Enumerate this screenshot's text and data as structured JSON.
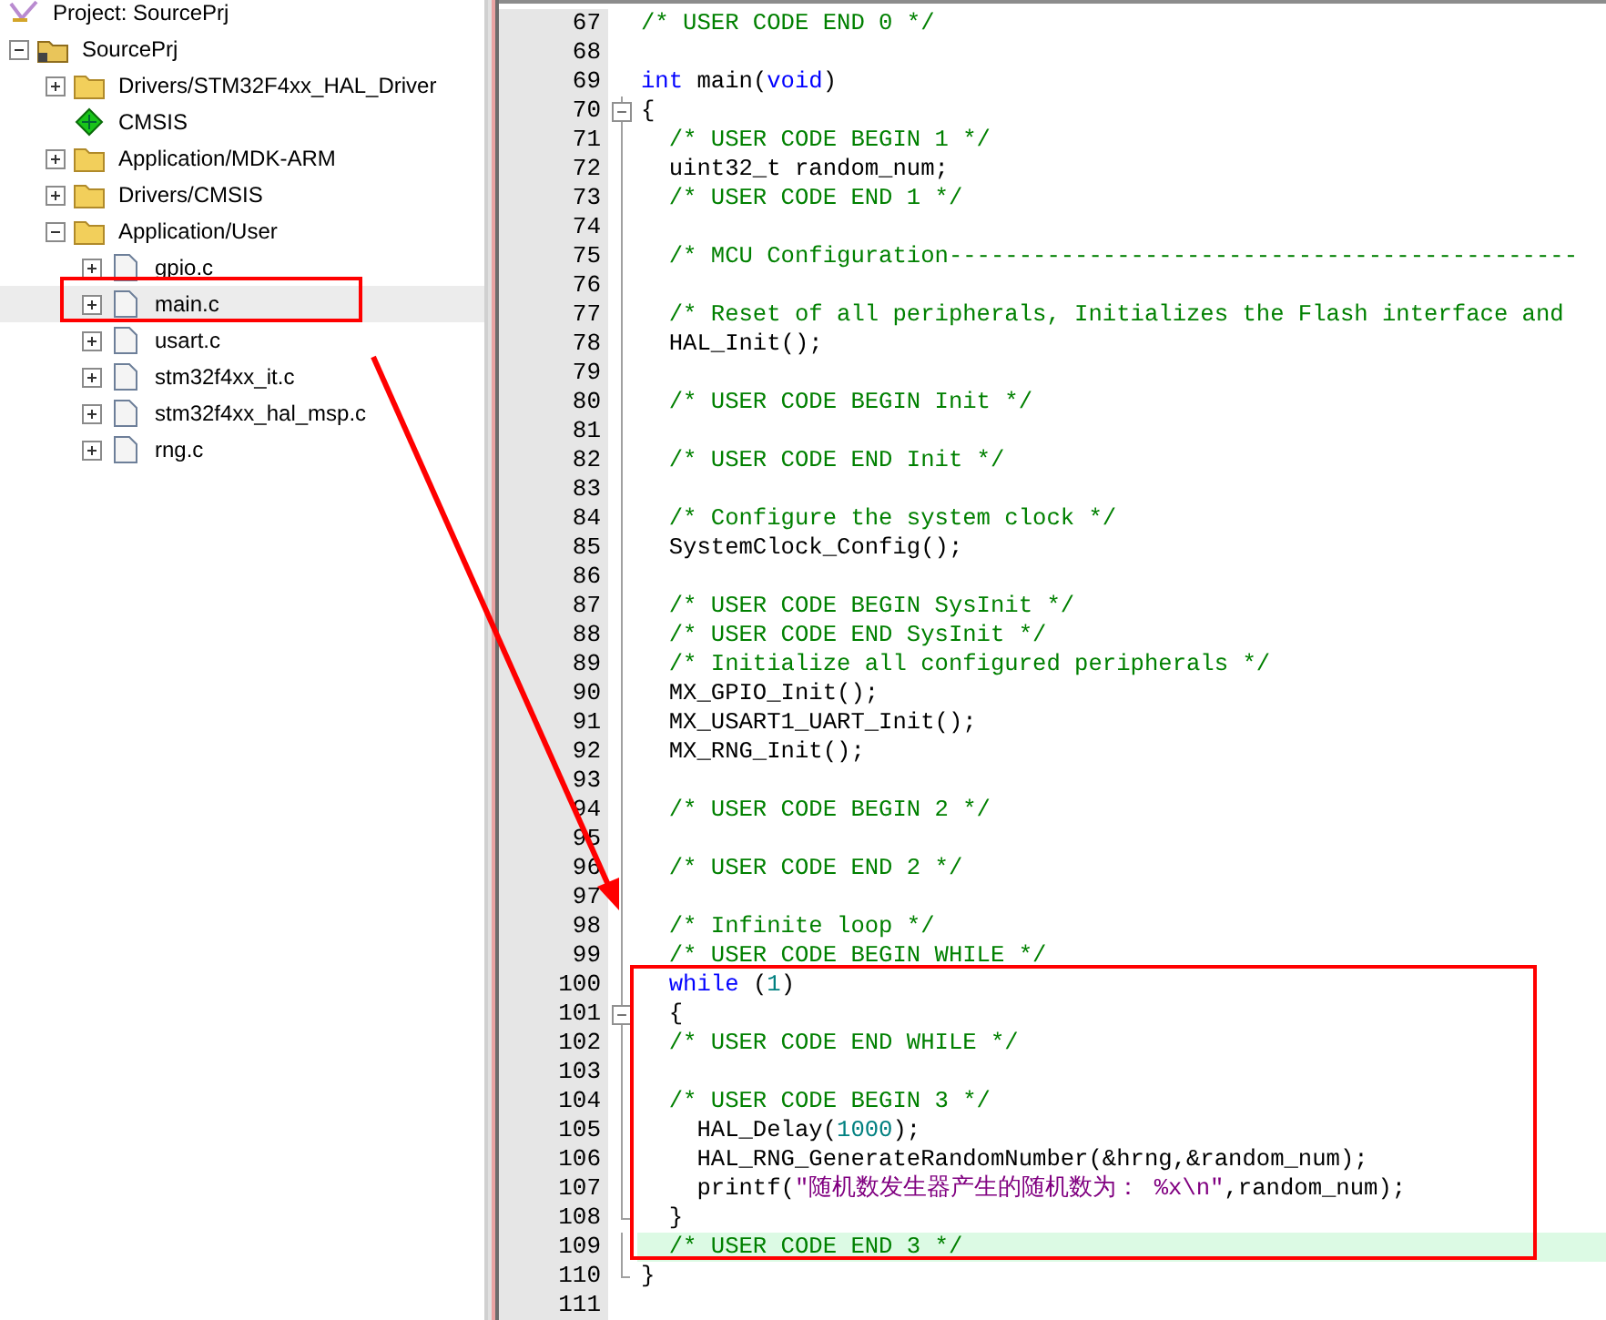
{
  "project_panel": {
    "title": "Project: SourcePrj",
    "tree": [
      {
        "label": "SourcePrj",
        "kind": "project",
        "expanded": true,
        "selected": false,
        "children": [
          {
            "label": "Drivers/STM32F4xx_HAL_Driver",
            "kind": "folder",
            "expanded": false,
            "selected": false
          },
          {
            "label": "CMSIS",
            "kind": "component",
            "selected": false
          },
          {
            "label": "Application/MDK-ARM",
            "kind": "folder",
            "expanded": false,
            "selected": false
          },
          {
            "label": "Drivers/CMSIS",
            "kind": "folder",
            "expanded": false,
            "selected": false
          },
          {
            "label": "Application/User",
            "kind": "folder",
            "expanded": true,
            "selected": false,
            "children": [
              {
                "label": "gpio.c",
                "kind": "file",
                "expanded": false,
                "selected": false
              },
              {
                "label": "main.c",
                "kind": "file",
                "expanded": false,
                "selected": true
              },
              {
                "label": "usart.c",
                "kind": "file",
                "expanded": false,
                "selected": false
              },
              {
                "label": "stm32f4xx_it.c",
                "kind": "file",
                "expanded": false,
                "selected": false
              },
              {
                "label": "stm32f4xx_hal_msp.c",
                "kind": "file",
                "expanded": false,
                "selected": false
              },
              {
                "label": "rng.c",
                "kind": "file",
                "expanded": false,
                "selected": false
              }
            ]
          }
        ]
      }
    ]
  },
  "editor": {
    "lines": [
      {
        "number": "67",
        "current": false,
        "kind": "plain",
        "tokens": [
          {
            "kind": "comment",
            "text": "/* USER CODE END 0 */"
          }
        ]
      },
      {
        "number": "68",
        "current": false,
        "kind": "plain"
      },
      {
        "number": "69",
        "current": false,
        "kind": "plain",
        "tokens": [
          {
            "kind": "keyword",
            "text": "int"
          },
          {
            "kind": "plain",
            "text": " main("
          },
          {
            "kind": "keyword",
            "text": "void"
          },
          {
            "kind": "plain",
            "text": ")"
          }
        ]
      },
      {
        "number": "70",
        "current": false,
        "kind": "open",
        "tokens": [
          {
            "kind": "plain",
            "text": "{"
          }
        ]
      },
      {
        "number": "71",
        "current": false,
        "kind": "body",
        "tokens": [
          {
            "kind": "comment",
            "text": "  /* USER CODE BEGIN 1 */"
          }
        ]
      },
      {
        "number": "72",
        "current": false,
        "kind": "body",
        "tokens": [
          {
            "kind": "plain",
            "text": "  uint32_t random_num;"
          }
        ]
      },
      {
        "number": "73",
        "current": false,
        "kind": "body",
        "tokens": [
          {
            "kind": "comment",
            "text": "  /* USER CODE END 1 */"
          }
        ]
      },
      {
        "number": "74",
        "current": false,
        "kind": "body"
      },
      {
        "number": "75",
        "current": false,
        "kind": "body",
        "tokens": [
          {
            "kind": "comment",
            "text": "  /* MCU Configuration---------------------------------------------"
          }
        ]
      },
      {
        "number": "76",
        "current": false,
        "kind": "body"
      },
      {
        "number": "77",
        "current": false,
        "kind": "body",
        "tokens": [
          {
            "kind": "comment",
            "text": "  /* Reset of all peripherals, Initializes the Flash interface and"
          }
        ]
      },
      {
        "number": "78",
        "current": false,
        "kind": "body",
        "tokens": [
          {
            "kind": "plain",
            "text": "  HAL_Init();"
          }
        ]
      },
      {
        "number": "79",
        "current": false,
        "kind": "body"
      },
      {
        "number": "80",
        "current": false,
        "kind": "body",
        "tokens": [
          {
            "kind": "comment",
            "text": "  /* USER CODE BEGIN Init */"
          }
        ]
      },
      {
        "number": "81",
        "current": false,
        "kind": "body"
      },
      {
        "number": "82",
        "current": false,
        "kind": "body",
        "tokens": [
          {
            "kind": "comment",
            "text": "  /* USER CODE END Init */"
          }
        ]
      },
      {
        "number": "83",
        "current": false,
        "kind": "body"
      },
      {
        "number": "84",
        "current": false,
        "kind": "body",
        "tokens": [
          {
            "kind": "comment",
            "text": "  /* Configure the system clock */"
          }
        ]
      },
      {
        "number": "85",
        "current": false,
        "kind": "body",
        "tokens": [
          {
            "kind": "plain",
            "text": "  SystemClock_Config();"
          }
        ]
      },
      {
        "number": "86",
        "current": false,
        "kind": "body"
      },
      {
        "number": "87",
        "current": false,
        "kind": "body",
        "tokens": [
          {
            "kind": "comment",
            "text": "  /* USER CODE BEGIN SysInit */"
          }
        ]
      },
      {
        "number": "88",
        "current": false,
        "kind": "body",
        "tokens": [
          {
            "kind": "comment",
            "text": "  /* USER CODE END SysInit */"
          }
        ]
      },
      {
        "number": "89",
        "current": false,
        "kind": "body",
        "tokens": [
          {
            "kind": "comment",
            "text": "  /* Initialize all configured peripherals */"
          }
        ]
      },
      {
        "number": "90",
        "current": false,
        "kind": "body",
        "tokens": [
          {
            "kind": "plain",
            "text": "  MX_GPIO_Init();"
          }
        ]
      },
      {
        "number": "91",
        "current": false,
        "kind": "body",
        "tokens": [
          {
            "kind": "plain",
            "text": "  MX_USART1_UART_Init();"
          }
        ]
      },
      {
        "number": "92",
        "current": false,
        "kind": "body",
        "tokens": [
          {
            "kind": "plain",
            "text": "  MX_RNG_Init();"
          }
        ]
      },
      {
        "number": "93",
        "current": false,
        "kind": "body"
      },
      {
        "number": "94",
        "current": false,
        "kind": "body",
        "tokens": [
          {
            "kind": "comment",
            "text": "  /* USER CODE BEGIN 2 */"
          }
        ]
      },
      {
        "number": "95",
        "current": false,
        "kind": "body"
      },
      {
        "number": "96",
        "current": false,
        "kind": "body",
        "tokens": [
          {
            "kind": "comment",
            "text": "  /* USER CODE END 2 */"
          }
        ]
      },
      {
        "number": "97",
        "current": false,
        "kind": "body"
      },
      {
        "number": "98",
        "current": false,
        "kind": "body",
        "tokens": [
          {
            "kind": "comment",
            "text": "  /* Infinite loop */"
          }
        ]
      },
      {
        "number": "99",
        "current": false,
        "kind": "body",
        "tokens": [
          {
            "kind": "comment",
            "text": "  /* USER CODE BEGIN WHILE */"
          }
        ]
      },
      {
        "number": "100",
        "current": false,
        "kind": "body",
        "tokens": [
          {
            "kind": "keyword",
            "text": "  while"
          },
          {
            "kind": "plain",
            "text": " ("
          },
          {
            "kind": "number",
            "text": "1"
          },
          {
            "kind": "plain",
            "text": ")"
          }
        ]
      },
      {
        "number": "101",
        "current": false,
        "kind": "open",
        "tokens": [
          {
            "kind": "plain",
            "text": "  {"
          }
        ]
      },
      {
        "number": "102",
        "current": false,
        "kind": "body",
        "tokens": [
          {
            "kind": "comment",
            "text": "  /* USER CODE END WHILE */"
          }
        ]
      },
      {
        "number": "103",
        "current": false,
        "kind": "body"
      },
      {
        "number": "104",
        "current": false,
        "kind": "body",
        "tokens": [
          {
            "kind": "comment",
            "text": "  /* USER CODE BEGIN 3 */"
          }
        ]
      },
      {
        "number": "105",
        "current": false,
        "kind": "body",
        "tokens": [
          {
            "kind": "plain",
            "text": "    HAL_Delay("
          },
          {
            "kind": "number",
            "text": "1000"
          },
          {
            "kind": "plain",
            "text": ");"
          }
        ]
      },
      {
        "number": "106",
        "current": false,
        "kind": "body",
        "tokens": [
          {
            "kind": "plain",
            "text": "    HAL_RNG_GenerateRandomNumber(&hrng,&random_num);"
          }
        ]
      },
      {
        "number": "107",
        "current": false,
        "kind": "body",
        "tokens": [
          {
            "kind": "plain",
            "text": "    printf("
          },
          {
            "kind": "string",
            "text": "\"随机数发生器产生的随机数为： %x\\n\""
          },
          {
            "kind": "plain",
            "text": ",random_num);"
          }
        ]
      },
      {
        "number": "108",
        "current": false,
        "kind": "end",
        "tokens": [
          {
            "kind": "plain",
            "text": "  }"
          }
        ]
      },
      {
        "number": "109",
        "current": true,
        "kind": "body",
        "tokens": [
          {
            "kind": "comment",
            "text": "  /* USER CODE END 3 */"
          }
        ]
      },
      {
        "number": "110",
        "current": false,
        "kind": "end",
        "tokens": [
          {
            "kind": "plain",
            "text": "}"
          }
        ]
      },
      {
        "number": "111",
        "current": false,
        "kind": "plain"
      }
    ]
  }
}
